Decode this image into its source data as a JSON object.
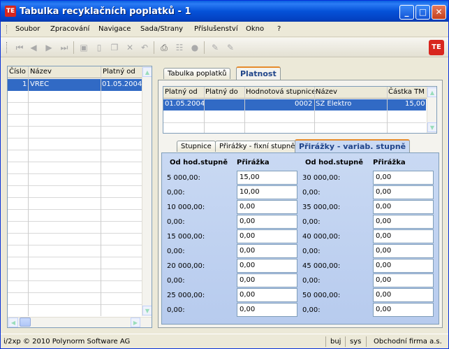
{
  "window": {
    "title": "Tabulka  recyklačních poplatků - 1",
    "app_icon": "TE",
    "brand_icon": "TE"
  },
  "menu": [
    "Soubor",
    "Zpracování",
    "Navigace",
    "Sada/Strany",
    "Příslušenství",
    "Okno",
    "?"
  ],
  "toolbar": {
    "icons": [
      "first-icon",
      "prev-icon",
      "next-icon",
      "last-icon",
      "save-icon",
      "new-icon",
      "copy-icon",
      "delete-icon",
      "undo-icon",
      "print-icon",
      "tree-icon",
      "cancel-icon",
      "edit-icon",
      "edit2-icon"
    ]
  },
  "left_grid": {
    "headers": [
      "Číslo",
      "Název",
      "Platný od"
    ],
    "rows": [
      {
        "cislo": "1",
        "nazev": "VREC",
        "platny_od": "01.05.2004"
      }
    ]
  },
  "main_tabs": [
    "Tabulka poplatků",
    "Platnost"
  ],
  "platnost_grid": {
    "headers": [
      "Platný od",
      "Platný do",
      "Hodnotová stupnice",
      "Název",
      "Částka TM"
    ],
    "rows": [
      {
        "platny_od": "01.05.2004",
        "platny_do": "",
        "stupnice": "0002",
        "nazev": "SZ Elektro",
        "castka": "15,00"
      }
    ]
  },
  "sub_tabs": [
    "Stupnice",
    "Přirážky - fixní stupně",
    "Přirážky - variab. stupně"
  ],
  "variab": {
    "col_od": "Od hod.stupně",
    "col_prirazka": "Přirážka",
    "left": [
      {
        "od": "5 000,00:",
        "prirazka": "15,00"
      },
      {
        "od": "0,00:",
        "prirazka": "10,00"
      },
      {
        "od": "10 000,00:",
        "prirazka": "0,00"
      },
      {
        "od": "0,00:",
        "prirazka": "0,00"
      },
      {
        "od": "15 000,00:",
        "prirazka": "0,00"
      },
      {
        "od": "0,00:",
        "prirazka": "0,00"
      },
      {
        "od": "20 000,00:",
        "prirazka": "0,00"
      },
      {
        "od": "0,00:",
        "prirazka": "0,00"
      },
      {
        "od": "25 000,00:",
        "prirazka": "0,00"
      },
      {
        "od": "0,00:",
        "prirazka": "0,00"
      }
    ],
    "right": [
      {
        "od": "30 000,00:",
        "prirazka": "0,00"
      },
      {
        "od": "0,00:",
        "prirazka": "0,00"
      },
      {
        "od": "35 000,00:",
        "prirazka": "0,00"
      },
      {
        "od": "0,00:",
        "prirazka": "0,00"
      },
      {
        "od": "40 000,00:",
        "prirazka": "0,00"
      },
      {
        "od": "0,00:",
        "prirazka": "0,00"
      },
      {
        "od": "45 000,00:",
        "prirazka": "0,00"
      },
      {
        "od": "0,00:",
        "prirazka": "0,00"
      },
      {
        "od": "50 000,00:",
        "prirazka": "0,00"
      },
      {
        "od": "0,00:",
        "prirazka": "0,00"
      }
    ]
  },
  "status": {
    "copyright": "i/2xp © 2010 Polynorm Software AG",
    "mode": "buj",
    "user": "sys",
    "company": "Obchodní firma a.s."
  }
}
